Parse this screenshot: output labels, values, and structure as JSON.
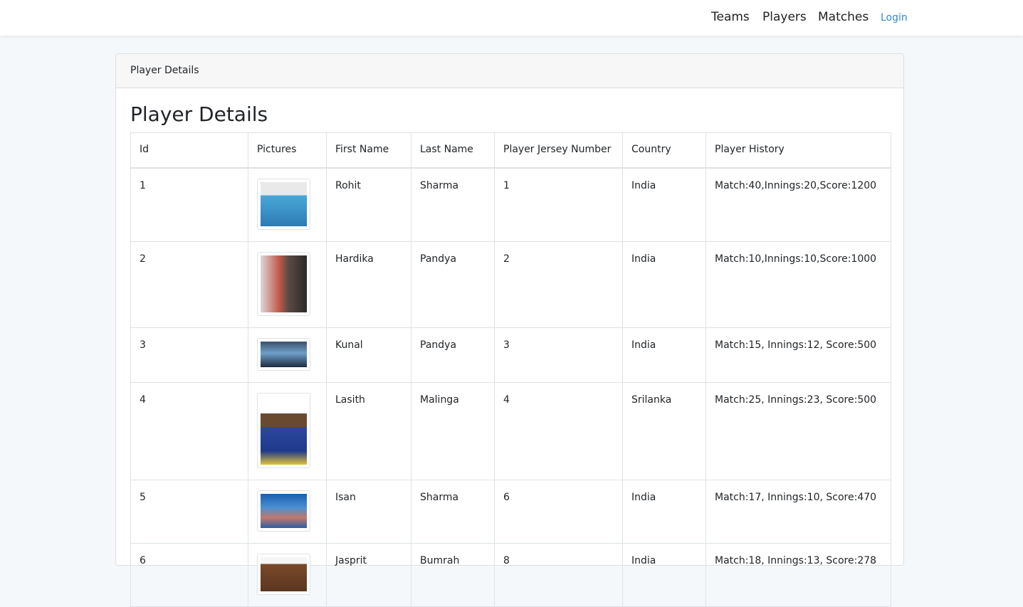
{
  "nav": {
    "teams": "Teams",
    "players": "Players",
    "matches": "Matches",
    "login": "Login"
  },
  "card": {
    "header": "Player Details",
    "title": "Player Details"
  },
  "table": {
    "columns": [
      "Id",
      "Pictures",
      "First Name",
      "Last Name",
      "Player Jersey Number",
      "Country",
      "Player History"
    ],
    "rows": [
      {
        "id": "1",
        "first": "Rohit",
        "last": "Sharma",
        "jersey": "1",
        "country": "India",
        "history": "Match:40,Innings:20,Score:1200"
      },
      {
        "id": "2",
        "first": "Hardika",
        "last": "Pandya",
        "jersey": "2",
        "country": "India",
        "history": "Match:10,Innings:10,Score:1000"
      },
      {
        "id": "3",
        "first": "Kunal",
        "last": "Pandya",
        "jersey": "3",
        "country": "India",
        "history": "Match:15, Innings:12, Score:500"
      },
      {
        "id": "4",
        "first": "Lasith",
        "last": "Malinga",
        "jersey": "4",
        "country": "Srilanka",
        "history": "Match:25, Innings:23, Score:500"
      },
      {
        "id": "5",
        "first": "Isan",
        "last": "Sharma",
        "jersey": "6",
        "country": "India",
        "history": "Match:17, Innings:10, Score:470"
      },
      {
        "id": "6",
        "first": "Jasprit",
        "last": "Bumrah",
        "jersey": "8",
        "country": "India",
        "history": "Match:18, Innings:13, Score:278"
      }
    ]
  }
}
